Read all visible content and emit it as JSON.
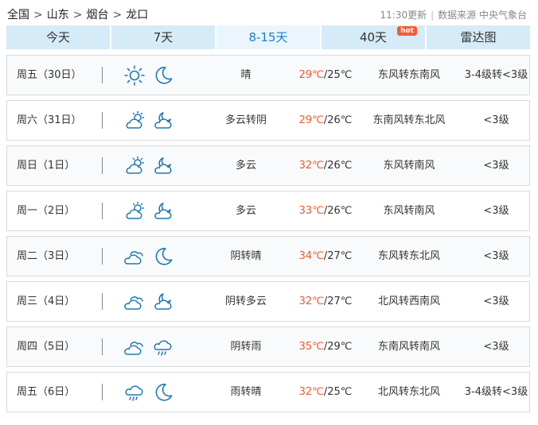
{
  "breadcrumb": {
    "items": [
      "全国",
      "山东",
      "烟台",
      "龙口"
    ],
    "separator": ">"
  },
  "source": {
    "updated": "11:30更新",
    "label": "数据来源 中央气象台"
  },
  "tabs": [
    {
      "label": "今天",
      "active": false
    },
    {
      "label": "7天",
      "active": false
    },
    {
      "label": "8-15天",
      "active": true
    },
    {
      "label": "40天",
      "active": false,
      "badge": "hot"
    },
    {
      "label": "雷达图",
      "active": false
    }
  ],
  "colors": {
    "tab_bg": "#d6ebf8",
    "tab_active_bg": "#eaf5fc",
    "tab_active_text": "#1a7fd0",
    "high_temp": "#f05a28",
    "icon": "#1d79b4",
    "badge": "#f25c3b"
  },
  "forecast": [
    {
      "day": "周五（30日）",
      "icons": [
        "sunny-icon",
        "clear-night-icon"
      ],
      "weather": "晴",
      "high": "29℃",
      "low": "/25℃",
      "wind": "东风转东南风",
      "level": "3-4级转<3级"
    },
    {
      "day": "周六（31日）",
      "icons": [
        "partly-cloudy-day-icon",
        "partly-cloudy-night-icon"
      ],
      "weather": "多云转阴",
      "high": "29℃",
      "low": "/26℃",
      "wind": "东南风转东北风",
      "level": "<3级"
    },
    {
      "day": "周日（1日）",
      "icons": [
        "partly-cloudy-day-icon",
        "partly-cloudy-night-icon"
      ],
      "weather": "多云",
      "high": "32℃",
      "low": "/26℃",
      "wind": "东风转南风",
      "level": "<3级"
    },
    {
      "day": "周一（2日）",
      "icons": [
        "partly-cloudy-day-icon",
        "partly-cloudy-night-icon"
      ],
      "weather": "多云",
      "high": "33℃",
      "low": "/26℃",
      "wind": "东风转南风",
      "level": "<3级"
    },
    {
      "day": "周二（3日）",
      "icons": [
        "overcast-icon",
        "clear-night-icon"
      ],
      "weather": "阴转晴",
      "high": "34℃",
      "low": "/27℃",
      "wind": "东风转东北风",
      "level": "<3级"
    },
    {
      "day": "周三（4日）",
      "icons": [
        "overcast-icon",
        "partly-cloudy-night-icon"
      ],
      "weather": "阴转多云",
      "high": "32℃",
      "low": "/27℃",
      "wind": "北风转西南风",
      "level": "<3级"
    },
    {
      "day": "周四（5日）",
      "icons": [
        "overcast-icon",
        "rain-icon"
      ],
      "weather": "阴转雨",
      "high": "35℃",
      "low": "/29℃",
      "wind": "东南风转南风",
      "level": "<3级"
    },
    {
      "day": "周五（6日）",
      "icons": [
        "rain-icon",
        "clear-night-icon"
      ],
      "weather": "雨转晴",
      "high": "32℃",
      "low": "/25℃",
      "wind": "北风转东北风",
      "level": "3-4级转<3级"
    }
  ]
}
